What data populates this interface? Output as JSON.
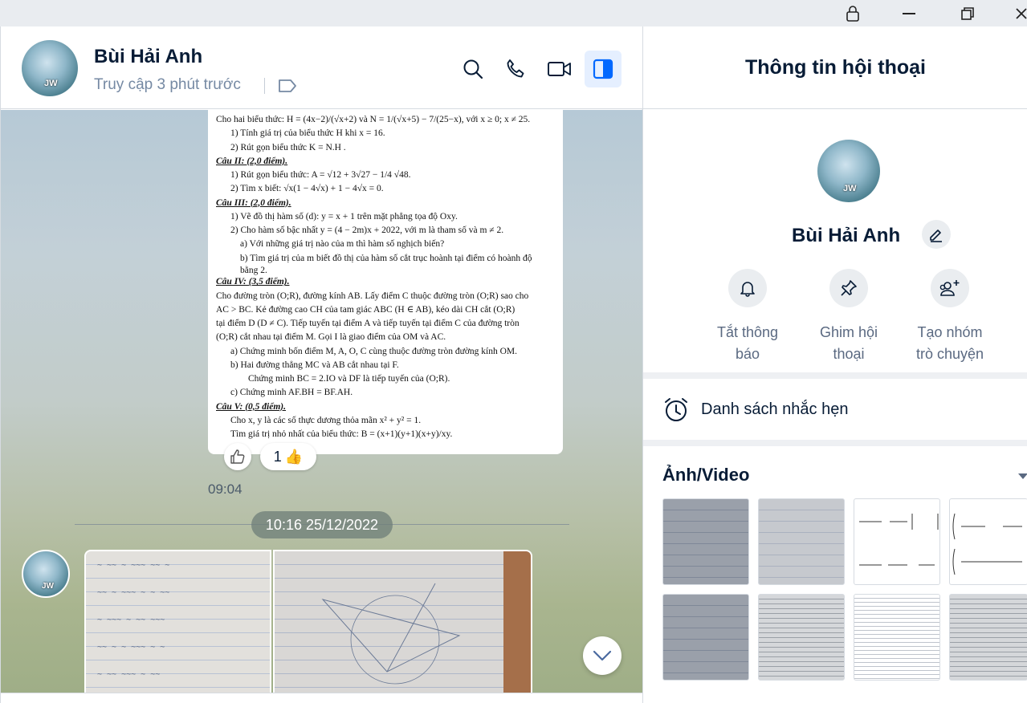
{
  "titlebar": {
    "icons": [
      "lock-icon",
      "minimize-icon",
      "restore-icon",
      "close-icon"
    ]
  },
  "header": {
    "name": "Bùi Hải Anh",
    "status": "Truy cập 3 phút trước",
    "avatar_text": "JW",
    "icons": [
      "search-icon",
      "phone-icon",
      "video-icon",
      "sidebar-toggle-icon"
    ]
  },
  "document": {
    "lines": [
      "Cho hai biểu thức: H = (4x−2)/(√x+2) và N = 1/(√x+5) − 7/(25−x), với x ≥ 0; x ≠ 25.",
      "1) Tính giá trị của biểu thức H khi x = 16.",
      "2) Rút gọn biểu thức K = N.H .",
      "Câu II: (2,0 điểm).",
      "1) Rút gọn biểu thức: A = √12 + 3√27 − 1/4 √48.",
      "2) Tìm x biết: √x(1 − 4√x) + 1 − 4√x = 0.",
      "Câu III: (2,0 điểm).",
      "1) Vẽ đồ thị hàm số (d): y = x + 1 trên mặt phẳng tọa độ Oxy.",
      "2) Cho hàm số bậc nhất y = (4 − 2m)x + 2022, với m là tham số và m ≠ 2.",
      "a) Với những giá trị nào của m thì hàm số nghịch biến?",
      "b) Tìm giá trị của m biết đồ thị của hàm số cắt trục hoành tại điểm có hoành độ",
      "bằng 2.",
      "Câu IV: (3,5 điểm).",
      "Cho đường tròn (O;R), đường kính AB. Lấy điểm C thuộc đường tròn (O;R) sao cho",
      "AC > BC. Kẻ đường cao CH của tam giác ABC (H ∈ AB), kéo dài CH cắt (O;R)",
      "tại điểm D (D ≠ C). Tiếp tuyến tại điểm A và tiếp tuyến tại điểm C của đường tròn",
      "(O;R) cắt nhau tại điểm M. Gọi I là giao điểm của OM và AC.",
      "a) Chứng minh bốn điểm M, A, O, C cùng thuộc đường tròn đường kính OM.",
      "b) Hai đường thẳng MC và AB cắt nhau tại F.",
      "Chứng minh BC = 2.IO và DF là tiếp tuyến của (O;R).",
      "c) Chứng minh AF.BH = BF.AH.",
      "Câu V: (0,5 điểm).",
      "Cho x, y là các số thực dương thỏa mãn x² + y² = 1.",
      "Tìm giá trị nhỏ nhất của biểu thức: B = (x+1)(y+1)(x+y)/xy."
    ]
  },
  "reactions": {
    "like_count": "1",
    "like_emoji": "👍"
  },
  "message_time": "09:04",
  "date_divider": "10:16 25/12/2022",
  "info_panel": {
    "title": "Thông tin hội thoại",
    "name": "Bùi Hải Anh",
    "actions": [
      {
        "line1": "Tắt thông",
        "line2": "báo"
      },
      {
        "line1": "Ghim hội",
        "line2": "thoại"
      },
      {
        "line1": "Tạo nhóm",
        "line2": "trò chuyện"
      }
    ],
    "reminder_label": "Danh sách nhắc hẹn",
    "media_label": "Ảnh/Video"
  }
}
